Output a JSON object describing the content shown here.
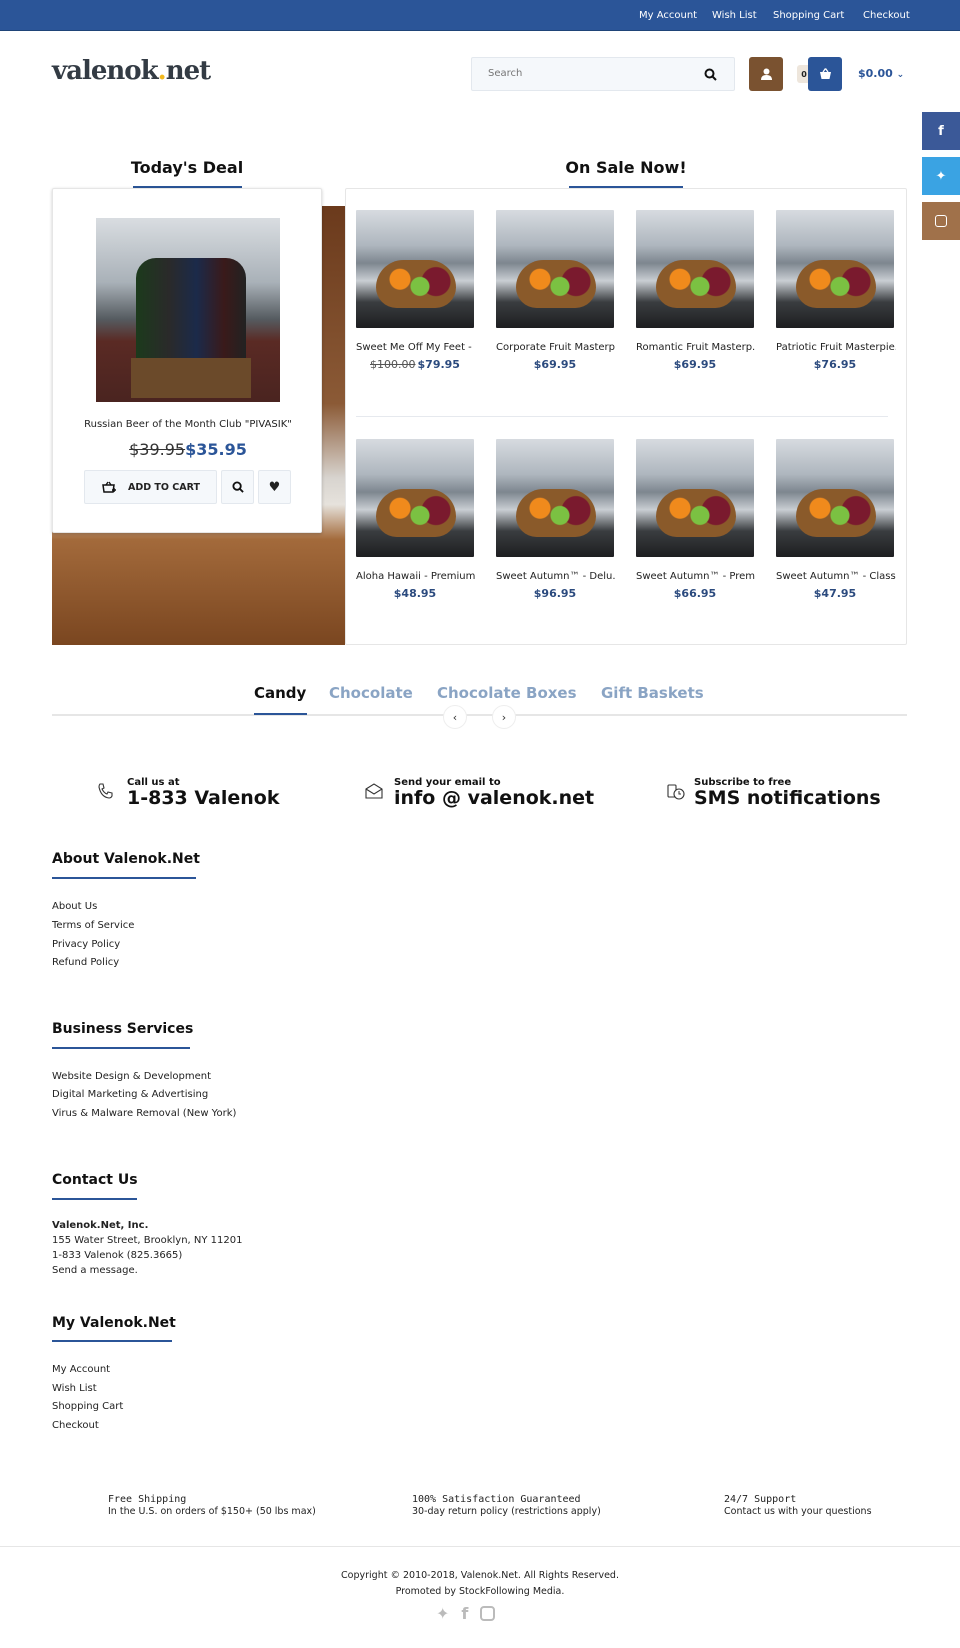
{
  "topbar": {
    "links": [
      "My Account",
      "Wish List",
      "Shopping Cart",
      "Checkout"
    ]
  },
  "header": {
    "logo": "valenok.net",
    "search_placeholder": "Search",
    "cart_count": "0",
    "cart_total": "$0.00"
  },
  "colors": {
    "brand": "#2b5598",
    "user_button": "#7a5230",
    "facebook": "#3b5998",
    "twitter": "#3aa3e3",
    "instagram": "#a0714a"
  },
  "deal": {
    "heading": "Today's Deal",
    "name": "Russian Beer of the Month Club \"PIVASIK\"",
    "old_price": "$39.95",
    "price": "$35.95",
    "add_to_cart": "ADD TO CART"
  },
  "sale": {
    "heading": "On Sale Now!",
    "products": [
      {
        "name": "Sweet Me Off My Feet - ..",
        "old_price": "$100.00",
        "price": "$79.95"
      },
      {
        "name": "Corporate Fruit Masterp..",
        "price": "$69.95"
      },
      {
        "name": "Romantic Fruit Masterp...",
        "price": "$69.95"
      },
      {
        "name": "Patriotic Fruit Masterpie..",
        "price": "$76.95"
      },
      {
        "name": "Aloha Hawaii - Premium..",
        "price": "$48.95"
      },
      {
        "name": "Sweet Autumn™ - Delu...",
        "price": "$96.95"
      },
      {
        "name": "Sweet Autumn™ - Prem..",
        "price": "$66.95"
      },
      {
        "name": "Sweet Autumn™ - Class..",
        "price": "$47.95"
      }
    ]
  },
  "tabs": [
    "Candy",
    "Chocolate",
    "Chocolate Boxes",
    "Gift Baskets"
  ],
  "contact_strip": [
    {
      "small": "Call us at",
      "big": "1-833 Valenok"
    },
    {
      "small": "Send your email to",
      "big": "info @ valenok.net"
    },
    {
      "small": "Subscribe to free",
      "big": "SMS notifications"
    }
  ],
  "footer": {
    "about": {
      "heading": "About Valenok.Net",
      "links": [
        "About Us",
        "Terms of Service",
        "Privacy Policy",
        "Refund Policy"
      ]
    },
    "business": {
      "heading": "Business Services",
      "links": [
        "Website Design & Development",
        "Digital Marketing & Advertising",
        "Virus & Malware Removal (New York)"
      ]
    },
    "contact": {
      "heading": "Contact Us",
      "company": "Valenok.Net, Inc.",
      "address": "155 Water Street, Brooklyn, NY 11201",
      "phone": "1-833 Valenok (825.3665)",
      "message": "Send a message."
    },
    "my": {
      "heading": "My Valenok.Net",
      "links": [
        "My Account",
        "Wish List",
        "Shopping Cart",
        "Checkout"
      ]
    },
    "features": [
      {
        "title": "Free Shipping",
        "text": "In the U.S. on orders of $150+ (50 lbs max)"
      },
      {
        "title": "100% Satisfaction Guaranteed",
        "text": "30-day return policy (restrictions apply)"
      },
      {
        "title": "24/7 Support",
        "text": "Contact us with your questions"
      }
    ],
    "copyright": "Copyright © 2010-2018, Valenok.Net. All Rights Reserved.",
    "promoted": "Promoted by StockFollowing Media."
  }
}
